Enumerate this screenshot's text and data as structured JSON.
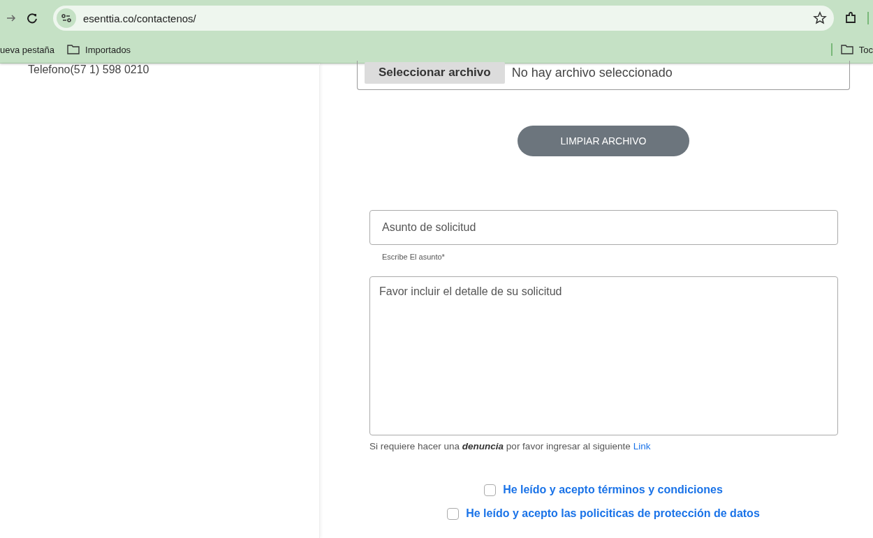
{
  "browser": {
    "url": "esenttia.co/contactenos/",
    "bookmarks": [
      {
        "label": "ueva pestaña",
        "kind": "page"
      },
      {
        "label": "Importados",
        "kind": "folder"
      }
    ],
    "bookmarks_right": [
      {
        "label": "Toc",
        "kind": "folder"
      }
    ]
  },
  "contact_phone": "Telefono(57 1) 598 0210",
  "file_input": {
    "button": "Seleccionar archivo",
    "status": "No hay archivo seleccionado"
  },
  "clear_button": "LIMPIAR ARCHIVO",
  "subject": {
    "placeholder": "Asunto de solicitud",
    "helper": "Escribe El asunto*"
  },
  "detail": {
    "placeholder": "Favor incluir el detalle de su solicitud"
  },
  "note": {
    "text": "Si requiere hacer una **denuncia** por favor ingresar al siguiente",
    "link": "Link"
  },
  "consents": [
    {
      "label": "He leído y acepto términos y condiciones",
      "checked": false
    },
    {
      "label": "He leído y acepto las policiticas de protección de datos",
      "checked": false
    }
  ]
}
